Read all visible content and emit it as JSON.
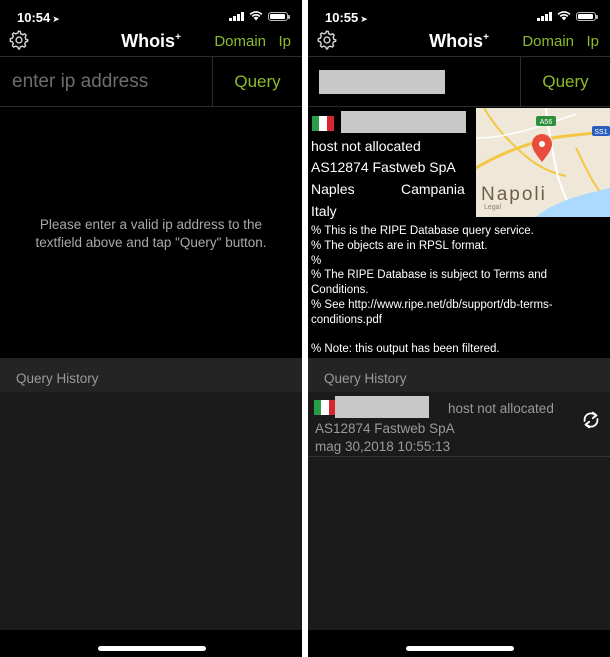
{
  "left": {
    "status": {
      "time": "10:54"
    },
    "nav": {
      "title": "Whois",
      "title_sup": "+",
      "domain": "Domain",
      "ip": "Ip"
    },
    "query": {
      "placeholder": "enter ip address",
      "button": "Query"
    },
    "empty_message": "Please enter a valid ip address to the textfield above and tap \"Query\" button.",
    "history": {
      "header": "Query History"
    }
  },
  "right": {
    "status": {
      "time": "10:55"
    },
    "nav": {
      "title": "Whois",
      "title_sup": "+",
      "domain": "Domain",
      "ip": "Ip"
    },
    "query": {
      "button": "Query"
    },
    "result": {
      "host": "host not allocated",
      "asn": "AS12874 Fastweb SpA",
      "city": "Naples",
      "region": "Campania",
      "country": "Italy",
      "map": {
        "city_label": "Napoli",
        "legal": "Legal",
        "road_1": "A56",
        "road_2": "SS1"
      },
      "whois_text": "% This is the RIPE Database query service.\n% The objects are in RPSL format.\n%\n% The RIPE Database is subject to Terms and Conditions.\n% See http://www.ripe.net/db/support/db-terms-conditions.pdf\n\n% Note: this output has been filtered."
    },
    "history": {
      "header": "Query History",
      "items": [
        {
          "status": "host not allocated",
          "asn": "AS12874 Fastweb SpA",
          "timestamp": "mag 30,2018  10:55:13"
        }
      ]
    }
  },
  "colors": {
    "accent": "#8cba2c",
    "background": "#000000",
    "history_bg": "#1b1b1b",
    "muted_text": "#9a9a9a"
  },
  "icons": {
    "settings": "gear-icon",
    "repeat": "repeat-icon",
    "location": "pin-icon"
  }
}
